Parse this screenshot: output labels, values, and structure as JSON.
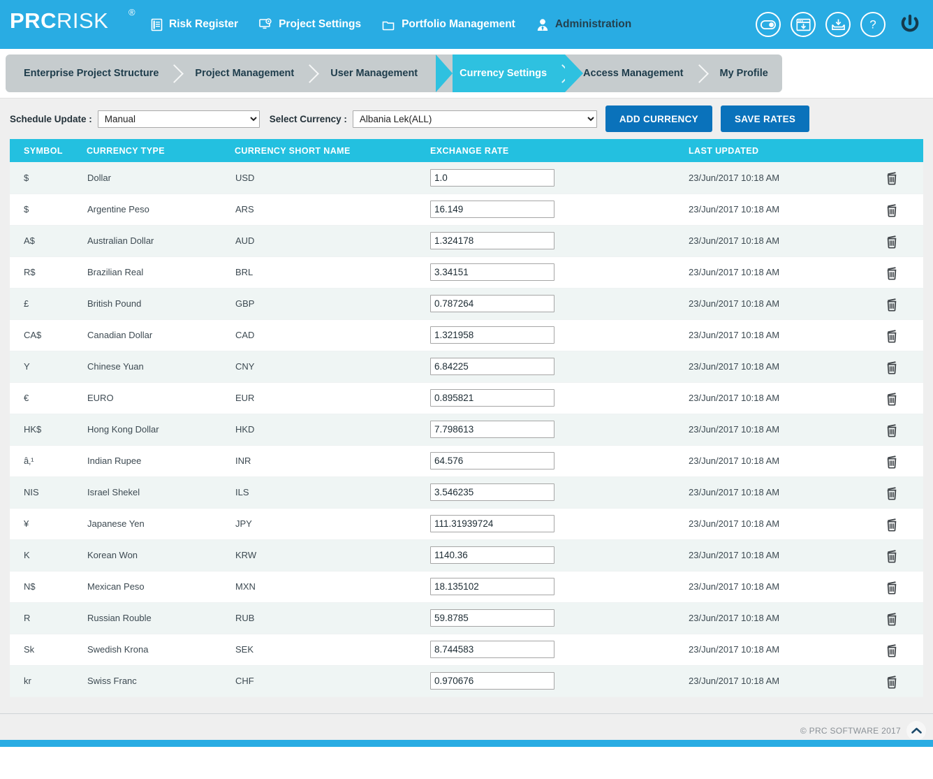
{
  "header": {
    "brand_bold": "PRC",
    "brand_light": "RISK",
    "brand_registered": "®",
    "nav": [
      {
        "label": "Risk Register",
        "icon": "document-list-icon",
        "active": false
      },
      {
        "label": "Project Settings",
        "icon": "project-settings-icon",
        "active": false
      },
      {
        "label": "Portfolio Management",
        "icon": "folder-icon",
        "active": false
      },
      {
        "label": "Administration",
        "icon": "user-icon",
        "active": true
      }
    ],
    "icons": [
      {
        "name": "toggle-switch-icon",
        "title": "Toggle"
      },
      {
        "name": "window-download-icon",
        "title": "Download Window"
      },
      {
        "name": "inbox-download-icon",
        "title": "Inbox"
      },
      {
        "name": "help-icon",
        "title": "Help"
      },
      {
        "name": "power-icon",
        "title": "Logout"
      }
    ]
  },
  "tabs": [
    {
      "label": "Enterprise Project Structure",
      "active": false
    },
    {
      "label": "Project Management",
      "active": false
    },
    {
      "label": "User Management",
      "active": false
    },
    {
      "label": "Currency Settings",
      "active": true
    },
    {
      "label": "Access Management",
      "active": false
    },
    {
      "label": "My Profile",
      "active": false
    }
  ],
  "toolbar": {
    "schedule_label": "Schedule Update :",
    "schedule_value": "Manual",
    "schedule_options": [
      "Manual"
    ],
    "currency_label": "Select Currency :",
    "currency_value": "Albania Lek(ALL)",
    "currency_options": [
      "Albania Lek(ALL)"
    ],
    "add_currency_label": "ADD CURRENCY",
    "save_rates_label": "SAVE RATES"
  },
  "table": {
    "columns": [
      "SYMBOL",
      "CURRENCY TYPE",
      "CURRENCY SHORT NAME",
      "EXCHANGE RATE",
      "LAST UPDATED"
    ],
    "rows": [
      {
        "symbol": "$",
        "type": "Dollar",
        "short": "USD",
        "rate": "1.0",
        "updated": "23/Jun/2017 10:18 AM"
      },
      {
        "symbol": "$",
        "type": "Argentine Peso",
        "short": "ARS",
        "rate": "16.149",
        "updated": "23/Jun/2017 10:18 AM"
      },
      {
        "symbol": "A$",
        "type": "Australian Dollar",
        "short": "AUD",
        "rate": "1.324178",
        "updated": "23/Jun/2017 10:18 AM"
      },
      {
        "symbol": "R$",
        "type": "Brazilian Real",
        "short": "BRL",
        "rate": "3.34151",
        "updated": "23/Jun/2017 10:18 AM"
      },
      {
        "symbol": "£",
        "type": "British Pound",
        "short": "GBP",
        "rate": "0.787264",
        "updated": "23/Jun/2017 10:18 AM"
      },
      {
        "symbol": "CA$",
        "type": "Canadian Dollar",
        "short": "CAD",
        "rate": "1.321958",
        "updated": "23/Jun/2017 10:18 AM"
      },
      {
        "symbol": "Y",
        "type": "Chinese Yuan",
        "short": "CNY",
        "rate": "6.84225",
        "updated": "23/Jun/2017 10:18 AM"
      },
      {
        "symbol": "€",
        "type": "EURO",
        "short": "EUR",
        "rate": "0.895821",
        "updated": "23/Jun/2017 10:18 AM"
      },
      {
        "symbol": "HK$",
        "type": "Hong Kong Dollar",
        "short": "HKD",
        "rate": "7.798613",
        "updated": "23/Jun/2017 10:18 AM"
      },
      {
        "symbol": "â‚¹",
        "type": "Indian Rupee",
        "short": "INR",
        "rate": "64.576",
        "updated": "23/Jun/2017 10:18 AM"
      },
      {
        "symbol": "NIS",
        "type": "Israel Shekel",
        "short": "ILS",
        "rate": "3.546235",
        "updated": "23/Jun/2017 10:18 AM"
      },
      {
        "symbol": "¥",
        "type": "Japanese Yen",
        "short": "JPY",
        "rate": "111.31939724",
        "updated": "23/Jun/2017 10:18 AM"
      },
      {
        "symbol": "K",
        "type": "Korean Won",
        "short": "KRW",
        "rate": "1140.36",
        "updated": "23/Jun/2017 10:18 AM"
      },
      {
        "symbol": "N$",
        "type": "Mexican Peso",
        "short": "MXN",
        "rate": "18.135102",
        "updated": "23/Jun/2017 10:18 AM"
      },
      {
        "symbol": "R",
        "type": "Russian Rouble",
        "short": "RUB",
        "rate": "59.8785",
        "updated": "23/Jun/2017 10:18 AM"
      },
      {
        "symbol": "Sk",
        "type": "Swedish Krona",
        "short": "SEK",
        "rate": "8.744583",
        "updated": "23/Jun/2017 10:18 AM"
      },
      {
        "symbol": "kr",
        "type": "Swiss Franc",
        "short": "CHF",
        "rate": "0.970676",
        "updated": "23/Jun/2017 10:18 AM"
      }
    ],
    "delete_icon": "trash-icon"
  },
  "footer": {
    "copyright": "© PRC SOFTWARE 2017",
    "scroll_top_icon": "chevron-up-icon"
  },
  "colors": {
    "brand_blue": "#29ace3",
    "table_header": "#23c0e0",
    "active_tab": "#2ec1e0",
    "button_blue": "#0a72bb",
    "tab_strip": "#c6ccce",
    "panel_bg": "#efefef",
    "row_odd": "#eff5f4"
  }
}
